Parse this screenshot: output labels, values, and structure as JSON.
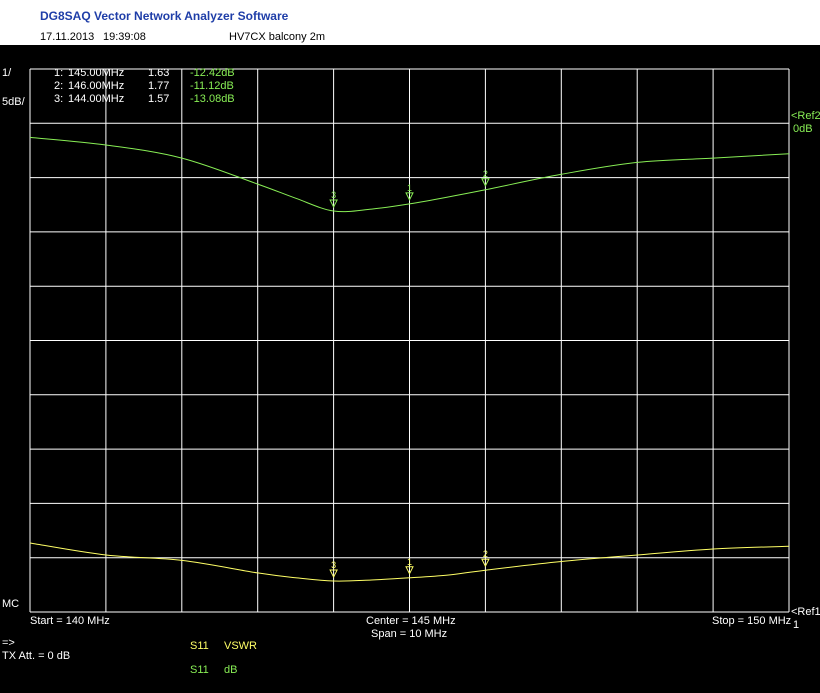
{
  "header": {
    "app_title": "DG8SAQ Vector Network Analyzer Software",
    "date": "17.11.2013",
    "time": "19:39:08",
    "description": "HV7CX balcony 2m"
  },
  "left_labels": {
    "scale_top": "1/",
    "scale_div": "5dB/",
    "mc": "MC",
    "arrow": "=>",
    "tx_att": "TX Att.  = 0 dB"
  },
  "markers": [
    {
      "label": "1:",
      "freq": "145.00MHz",
      "vswr": "1.63",
      "db": "-12.42dB"
    },
    {
      "label": "2:",
      "freq": "146.00MHz",
      "vswr": "1.77",
      "db": "-11.12dB"
    },
    {
      "label": "3:",
      "freq": "144.00MHz",
      "vswr": "1.57",
      "db": "-13.08dB"
    }
  ],
  "ref_labels": {
    "ref2": "<Ref2",
    "ref2_value": "0dB",
    "ref1": "<Ref1",
    "ref1_value": "1"
  },
  "footer": {
    "start": "Start = 140 MHz",
    "center": "Center = 145 MHz",
    "span": "Span = 10 MHz",
    "stop": "Stop = 150 MHz"
  },
  "legend": [
    {
      "param": "S11",
      "format": "VSWR",
      "color": "#ffff66"
    },
    {
      "param": "S11",
      "format": "dB",
      "color": "#88ee55"
    }
  ],
  "chart_data": {
    "type": "line",
    "x_unit": "MHz",
    "xlim": [
      140,
      150
    ],
    "x_divisions": 10,
    "y_divisions": 10,
    "grid": true,
    "series": [
      {
        "name": "S11 dB",
        "color": "#88ee55",
        "scale": "5 dB/div, ref 0 dB at top",
        "ylim": [
          -50,
          0
        ],
        "x": [
          140,
          141,
          142,
          143,
          143.5,
          144,
          144.5,
          145,
          145.5,
          146,
          147,
          148,
          149,
          150
        ],
        "y": [
          -6.3,
          -7.0,
          -8.2,
          -10.6,
          -11.9,
          -13.08,
          -12.9,
          -12.42,
          -11.8,
          -11.12,
          -9.7,
          -8.6,
          -8.2,
          -7.8
        ]
      },
      {
        "name": "S11 VSWR",
        "color": "#ffff66",
        "scale": "1 at bottom (Ref1)",
        "ylim": [
          1,
          11
        ],
        "x": [
          140,
          141,
          142,
          143,
          143.5,
          144,
          144.5,
          145,
          145.5,
          146,
          147,
          148,
          149,
          150
        ],
        "y": [
          2.27,
          2.05,
          1.95,
          1.72,
          1.63,
          1.57,
          1.59,
          1.63,
          1.68,
          1.77,
          1.93,
          2.05,
          2.16,
          2.21
        ]
      }
    ],
    "marker_x": [
      145,
      146,
      144
    ],
    "marker_labels": [
      "1",
      "2",
      "3"
    ]
  }
}
